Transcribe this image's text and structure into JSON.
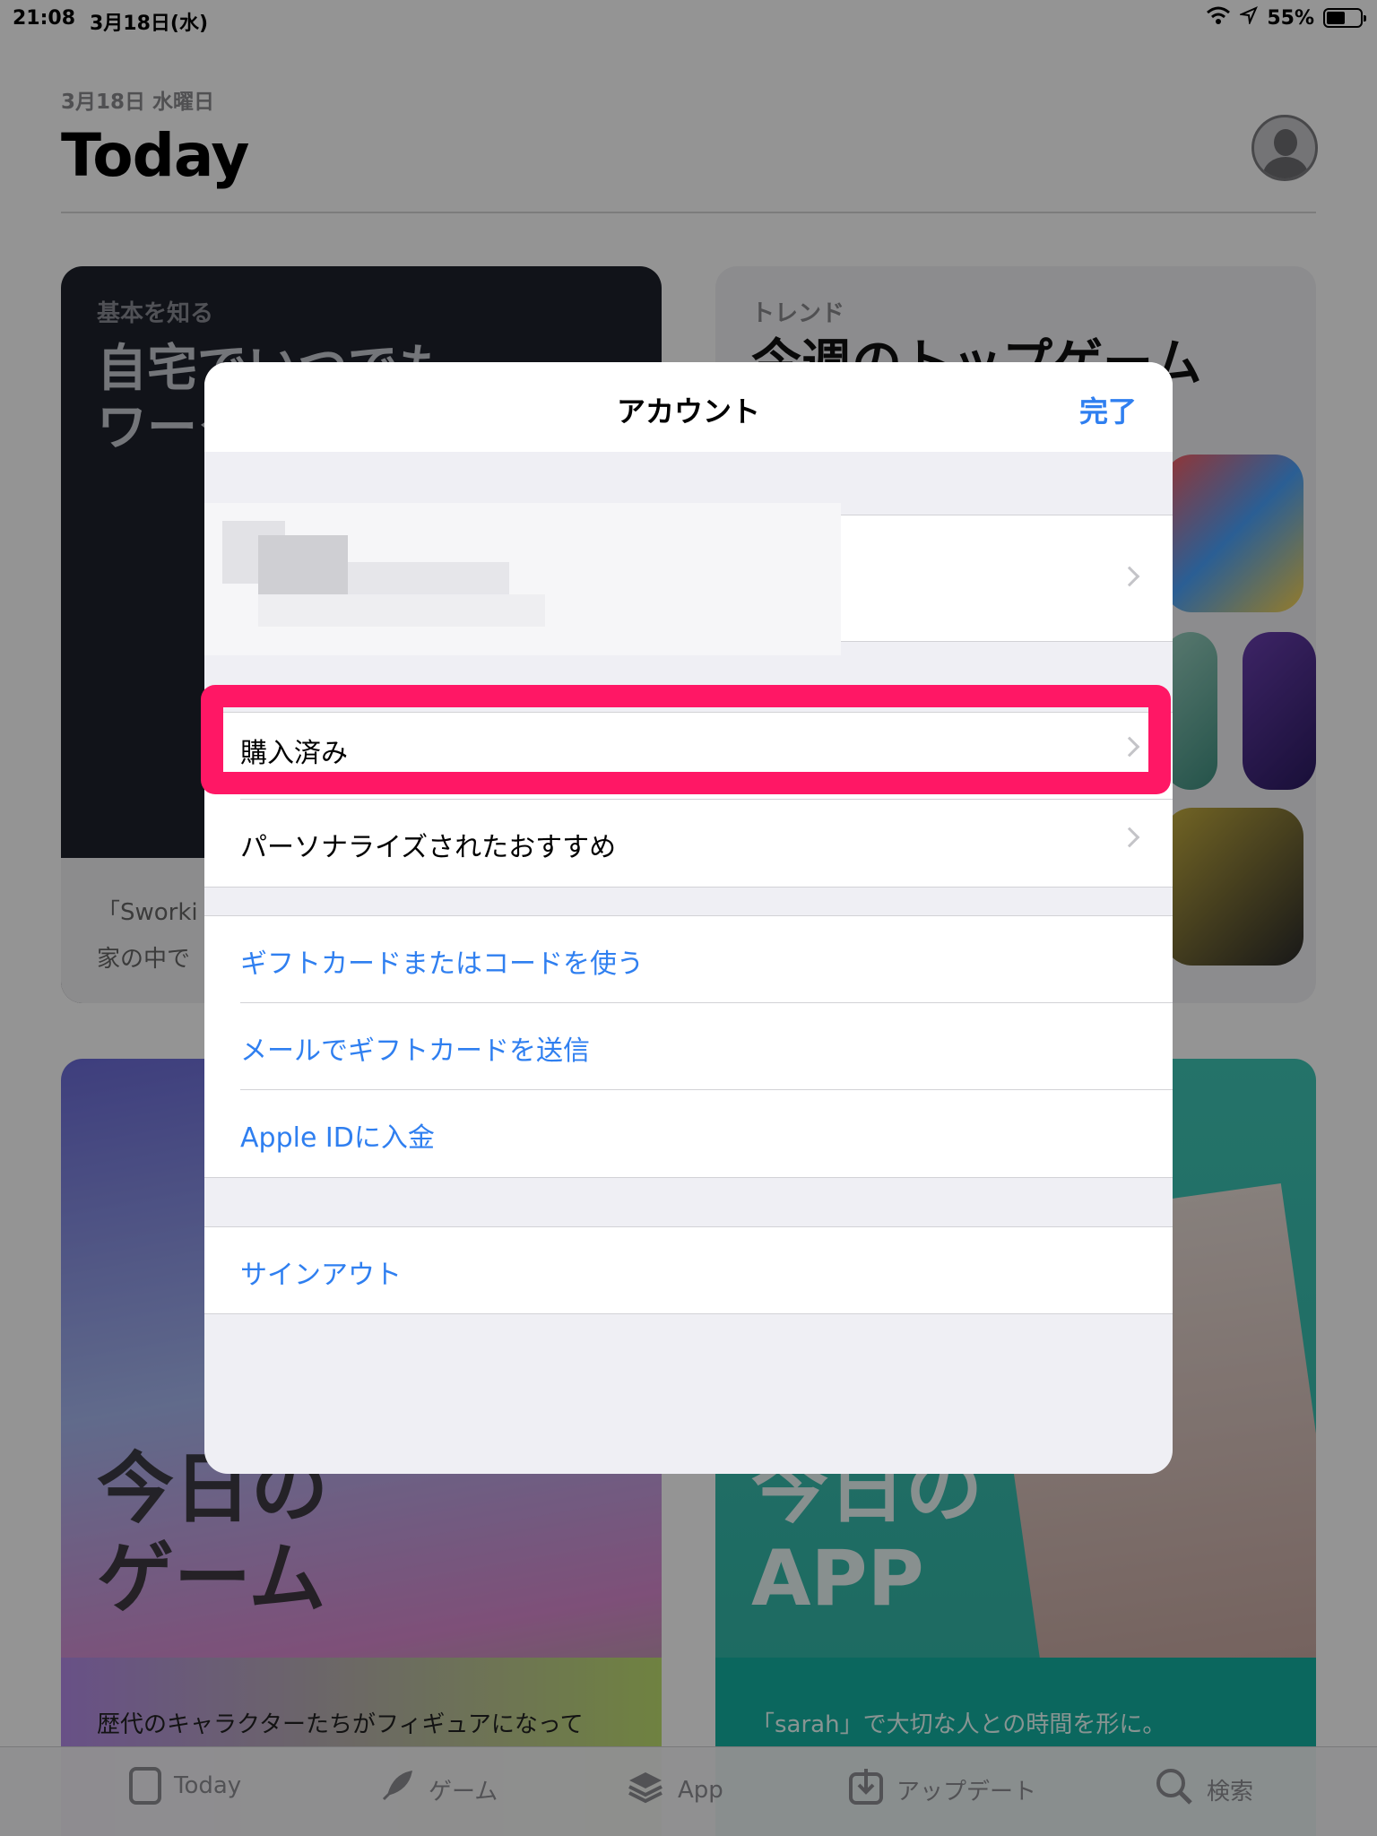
{
  "status_bar": {
    "time": "21:08",
    "date": "3月18日(水)",
    "battery_percent": "55%",
    "battery_level": 0.55
  },
  "header": {
    "date": "3月18日 水曜日",
    "title": "Today"
  },
  "cards": [
    {
      "eyebrow": "基本を知る",
      "headline": "自宅でいつでも\nワーク",
      "sub": "「Sworki",
      "sub2": "家の中で"
    },
    {
      "eyebrow": "トレンド",
      "headline": "今週のトップゲーム"
    },
    {
      "overlay_title": "今日の\nゲーム",
      "caption": "歴代のキャラクターたちがフィギュアになって"
    },
    {
      "overlay_title": "今日の\nAPP",
      "caption": "「sarah」で大切な人との時間を形に。"
    }
  ],
  "tab_bar": {
    "tabs": [
      {
        "label": "Today",
        "icon": "today-icon"
      },
      {
        "label": "ゲーム",
        "icon": "rocket-icon"
      },
      {
        "label": "App",
        "icon": "layers-icon"
      },
      {
        "label": "アップデート",
        "icon": "download-icon"
      },
      {
        "label": "検索",
        "icon": "search-icon"
      }
    ]
  },
  "modal": {
    "title": "アカウント",
    "done_label": "完了",
    "rows": {
      "purchased": "購入済み",
      "personalized": "パーソナライズされたおすすめ",
      "redeem": "ギフトカードまたはコードを使う",
      "send_gift": "メールでギフトカードを送信",
      "add_funds": "Apple IDに入金",
      "sign_out": "サインアウト"
    }
  },
  "colors": {
    "accent": "#2f7ff0",
    "highlight": "#ff1765"
  }
}
